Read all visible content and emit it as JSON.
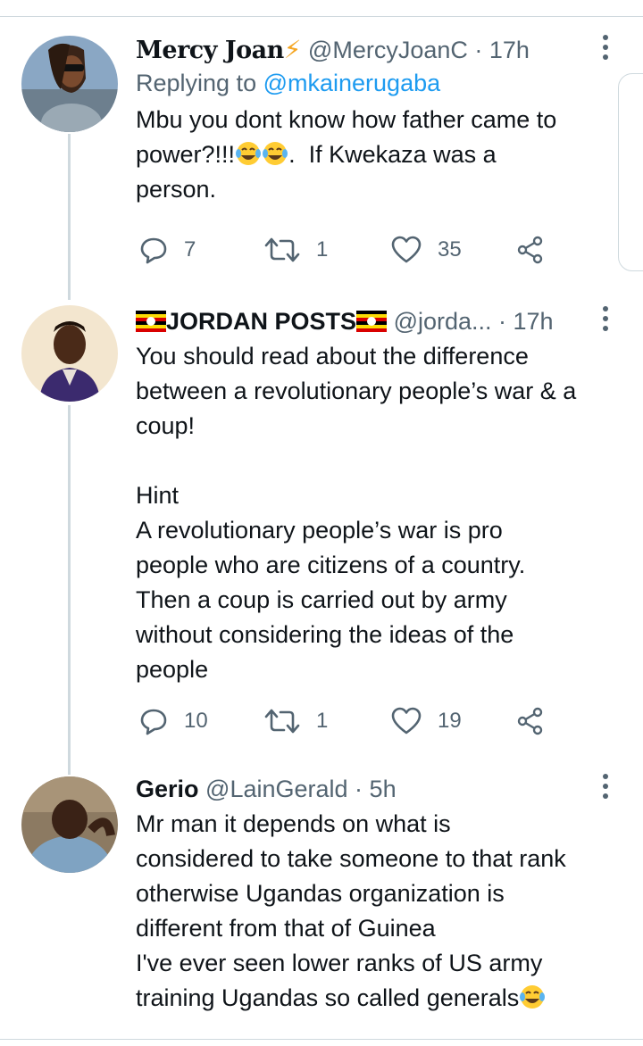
{
  "tweets": [
    {
      "name": "Mercy Joan",
      "name_suffix_icon": "lightning-bolt-emoji",
      "handle": "@MercyJoanC",
      "time": "17h",
      "replying_prefix": "Replying to ",
      "replying_to": "@mkainerugaba",
      "text_parts": [
        "Mbu you dont know how father came to\npower?!!!",
        ".  If Kwekaza was a\nperson."
      ],
      "emoji_inline": "tears-of-joy-emoji",
      "replies": "7",
      "retweets": "1",
      "likes": "35"
    },
    {
      "name": "JORDAN POSTS",
      "name_flag_icon": "uganda-flag-emoji",
      "handle": "@jorda...",
      "time": "17h",
      "text": "You should read about the difference\nbetween a revolutionary people’s war & a\ncoup!\n\nHint\nA revolutionary people’s war is pro\npeople who are citizens of a country.\nThen a coup is carried out by army\nwithout considering the ideas of the\npeople",
      "replies": "10",
      "retweets": "1",
      "likes": "19"
    },
    {
      "name": "Gerio",
      "handle": "@LainGerald",
      "time": "5h",
      "text": "Mr man it depends on what is\nconsidered to take someone to that rank\notherwise Ugandas organization is\ndifferent from that of Guinea\nI've ever seen lower ranks of US army\ntraining Ugandas so called generals",
      "emoji_end": "tears-of-joy-emoji"
    }
  ],
  "separator": " · ",
  "colors": {
    "text": "#0f1419",
    "secondary": "#536471",
    "link": "#1d9bf0",
    "thread_line": "#cfd9de"
  }
}
